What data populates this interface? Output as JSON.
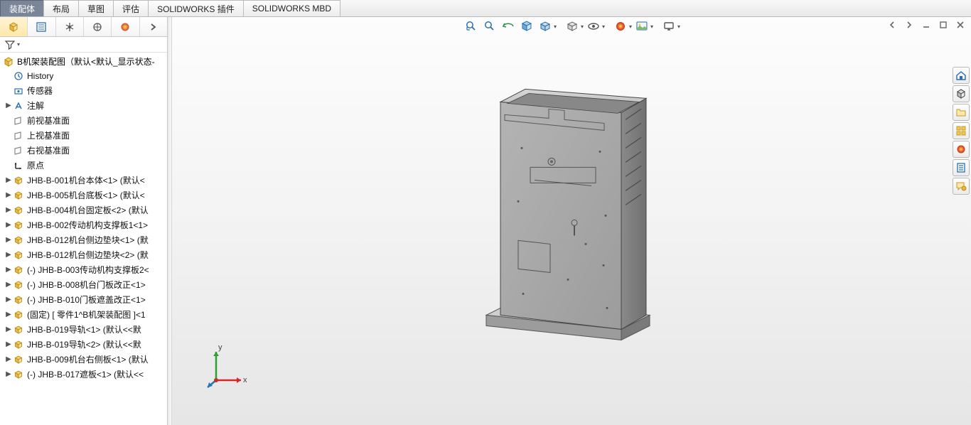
{
  "mainTabs": {
    "items": [
      {
        "label": "装配体",
        "active": true
      },
      {
        "label": "布局",
        "active": false
      },
      {
        "label": "草图",
        "active": false
      },
      {
        "label": "评估",
        "active": false
      },
      {
        "label": "SOLIDWORKS 插件",
        "active": false
      },
      {
        "label": "SOLIDWORKS MBD",
        "active": false
      }
    ]
  },
  "panelTabs": [
    {
      "name": "assembly-icon"
    },
    {
      "name": "properties-icon"
    },
    {
      "name": "config-icon"
    },
    {
      "name": "display-icon"
    },
    {
      "name": "appearance-icon"
    },
    {
      "name": "more-icon"
    }
  ],
  "tree": {
    "root": "B机架装配图（默认<默认_显示状态-",
    "items": [
      {
        "icon": "history",
        "label": "History",
        "expand": ""
      },
      {
        "icon": "sensor",
        "label": "传感器",
        "expand": ""
      },
      {
        "icon": "annot",
        "label": "注解",
        "expand": "▶"
      },
      {
        "icon": "plane",
        "label": "前视基准面",
        "expand": ""
      },
      {
        "icon": "plane",
        "label": "上视基准面",
        "expand": ""
      },
      {
        "icon": "plane",
        "label": "右视基准面",
        "expand": ""
      },
      {
        "icon": "origin",
        "label": "原点",
        "expand": ""
      },
      {
        "icon": "part",
        "label": "JHB-B-001机台本体<1>  (默认<",
        "expand": "▶"
      },
      {
        "icon": "part",
        "label": "JHB-B-005机台底板<1>  (默认<",
        "expand": "▶"
      },
      {
        "icon": "part",
        "label": "JHB-B-004机台固定板<2>  (默认",
        "expand": "▶"
      },
      {
        "icon": "part",
        "label": "JHB-B-002传动机构支撑板1<1>",
        "expand": "▶"
      },
      {
        "icon": "part",
        "label": "JHB-B-012机台侧边垫块<1>  (默",
        "expand": "▶"
      },
      {
        "icon": "part",
        "label": "JHB-B-012机台侧边垫块<2>  (默",
        "expand": "▶"
      },
      {
        "icon": "part",
        "label": "(-) JHB-B-003传动机构支撑板2<",
        "expand": "▶"
      },
      {
        "icon": "part",
        "label": "(-) JHB-B-008机台门板改正<1>",
        "expand": "▶"
      },
      {
        "icon": "part",
        "label": "(-) JHB-B-010门板遮盖改正<1>",
        "expand": "▶"
      },
      {
        "icon": "part",
        "label": "(固定) [ 零件1^B机架装配图 ]<1",
        "expand": "▶"
      },
      {
        "icon": "part",
        "label": "JHB-B-019导轨<1>  (默认<<默",
        "expand": "▶"
      },
      {
        "icon": "part",
        "label": "JHB-B-019导轨<2>  (默认<<默",
        "expand": "▶"
      },
      {
        "icon": "part",
        "label": "JHB-B-009机台右侧板<1>  (默认",
        "expand": "▶"
      },
      {
        "icon": "part",
        "label": "(-) JHB-B-017遮板<1>  (默认<<",
        "expand": "▶"
      }
    ]
  },
  "triad": {
    "x": "x",
    "y": "y"
  },
  "colors": {
    "accent": "#4a90d9",
    "partYellow": "#e8b83a",
    "partShadow": "#b88c1c",
    "red": "#d62728",
    "green": "#2ca02c",
    "blue": "#1f77b4"
  }
}
